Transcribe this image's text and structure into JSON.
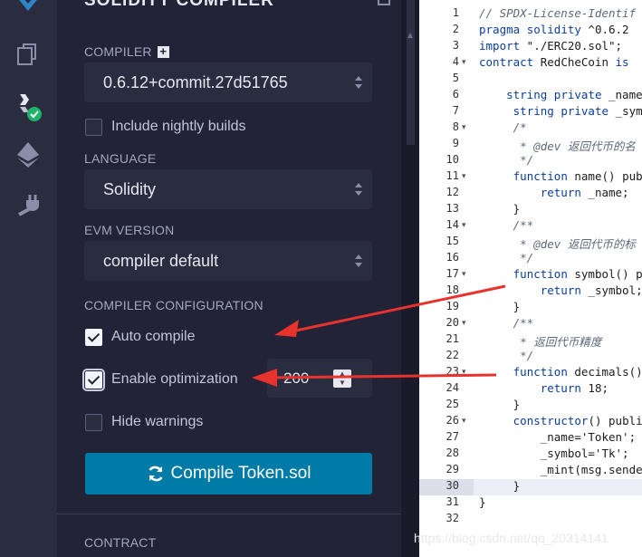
{
  "panel": {
    "title": "SOLIDITY COMPILER",
    "compiler_label": "COMPILER",
    "compiler_value": "0.6.12+commit.27d51765",
    "nightly_label": "Include nightly builds",
    "language_label": "LANGUAGE",
    "language_value": "Solidity",
    "evm_label": "EVM VERSION",
    "evm_value": "compiler default",
    "config_label": "COMPILER CONFIGURATION",
    "auto_compile_label": "Auto compile",
    "optimization_label": "Enable optimization",
    "runs_value": "200",
    "hide_warnings_label": "Hide warnings",
    "compile_button": "Compile Token.sol",
    "contract_label": "CONTRACT"
  },
  "icons": [
    "remix-logo-icon",
    "file-explorer-icon",
    "solidity-compiler-icon",
    "deploy-run-icon",
    "plugin-manager-icon"
  ],
  "colors": {
    "accent": "#007aa6",
    "panel_bg": "#222336",
    "check_green": "#1fb36b",
    "arrow_red": "#e8322e"
  },
  "editor": {
    "line_numbers": [
      "1",
      "2",
      "3",
      "4",
      "5",
      "6",
      "7",
      "8",
      "9",
      "10",
      "11",
      "12",
      "13",
      "14",
      "15",
      "16",
      "17",
      "18",
      "19",
      "20",
      "21",
      "22",
      "23",
      "24",
      "25",
      "26",
      "27",
      "28",
      "29",
      "30",
      "31",
      "32"
    ],
    "fold_lines": [
      4,
      8,
      11,
      14,
      17,
      20,
      23,
      26
    ],
    "lines": [
      "// SPDX-License-Identif",
      "pragma solidity ^0.6.2",
      "import \"./ERC20.sol\";",
      "contract RedCheCoin is ",
      "",
      "    string private _name",
      "     string private _sym",
      "     /*",
      "      * @dev 返回代币的名",
      "      */",
      "     function name() publ",
      "         return _name;",
      "     }",
      "     /**",
      "      * @dev 返回代币的标",
      "      */",
      "     function symbol() p",
      "         return _symbol;",
      "     }",
      "     /**",
      "      * 返回代币精度",
      "      */",
      "     function decimals()",
      "         return 18;",
      "     }",
      "     constructor() publi",
      "         _name='Token';",
      "         _symbol='Tk';",
      "         _mint(msg.sende",
      "     }",
      "}",
      ""
    ]
  },
  "watermark": "https://blog.csdn.net/qq_20314141"
}
